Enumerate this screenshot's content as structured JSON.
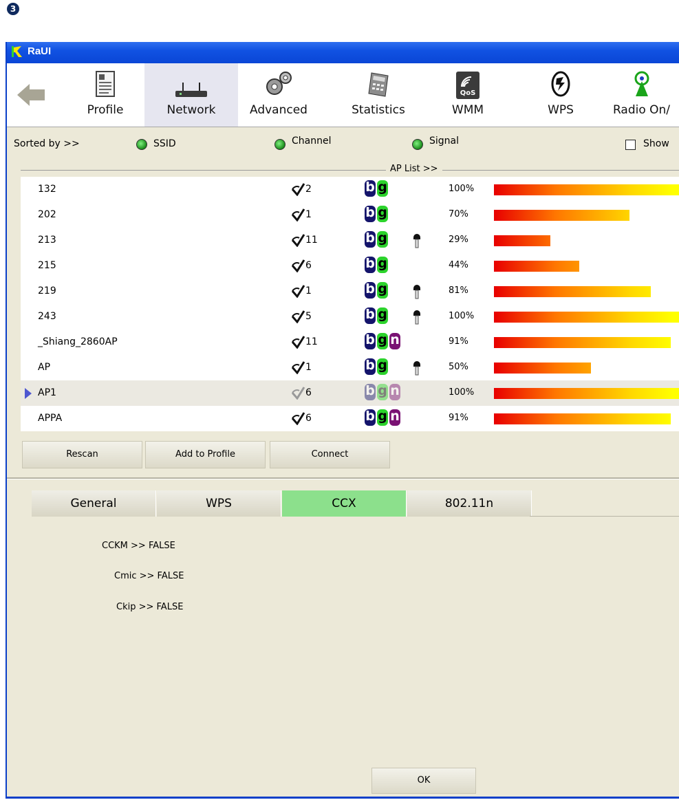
{
  "step_badge": "3",
  "window": {
    "title": "RaUI"
  },
  "toolbar": {
    "items": [
      {
        "label": "Profile"
      },
      {
        "label": "Network"
      },
      {
        "label": "Advanced"
      },
      {
        "label": "Statistics"
      },
      {
        "label": "WMM",
        "icon_text": "QoS"
      },
      {
        "label": "WPS"
      },
      {
        "label": "Radio On/"
      }
    ]
  },
  "sort": {
    "label": "Sorted by >>",
    "options": [
      "SSID",
      "Channel",
      "Signal"
    ],
    "show_checkbox_label": "Show"
  },
  "ap_list": {
    "label": "AP List >>",
    "rows": [
      {
        "ssid": "132",
        "channel": "2",
        "modes": [
          "b",
          "g"
        ],
        "secured": false,
        "signal_text": "100%",
        "signal": 100
      },
      {
        "ssid": "202",
        "channel": "1",
        "modes": [
          "b",
          "g"
        ],
        "secured": false,
        "signal_text": "70%",
        "signal": 70
      },
      {
        "ssid": "213",
        "channel": "11",
        "modes": [
          "b",
          "g"
        ],
        "secured": true,
        "signal_text": "29%",
        "signal": 29
      },
      {
        "ssid": "215",
        "channel": "6",
        "modes": [
          "b",
          "g"
        ],
        "secured": false,
        "signal_text": "44%",
        "signal": 44
      },
      {
        "ssid": "219",
        "channel": "1",
        "modes": [
          "b",
          "g"
        ],
        "secured": true,
        "signal_text": "81%",
        "signal": 81
      },
      {
        "ssid": "243",
        "channel": "5",
        "modes": [
          "b",
          "g"
        ],
        "secured": true,
        "signal_text": "100%",
        "signal": 100
      },
      {
        "ssid": "_Shiang_2860AP",
        "channel": "11",
        "modes": [
          "b",
          "g",
          "n"
        ],
        "secured": false,
        "signal_text": "91%",
        "signal": 91
      },
      {
        "ssid": "AP",
        "channel": "1",
        "modes": [
          "b",
          "g"
        ],
        "secured": true,
        "signal_text": "50%",
        "signal": 50
      },
      {
        "ssid": "AP1",
        "channel": "6",
        "modes": [
          "b",
          "g",
          "n"
        ],
        "secured": false,
        "signal_text": "100%",
        "signal": 100,
        "selected": true
      },
      {
        "ssid": "APPA",
        "channel": "6",
        "modes": [
          "b",
          "g",
          "n"
        ],
        "secured": false,
        "signal_text": "91%",
        "signal": 91
      }
    ]
  },
  "buttons": {
    "rescan": "Rescan",
    "add_to_profile": "Add to Profile",
    "connect": "Connect"
  },
  "tabs": [
    "General",
    "WPS",
    "CCX",
    "802.11n"
  ],
  "active_tab": "CCX",
  "ccx": {
    "cckm": "CCKM >> FALSE",
    "cmic": "Cmic >> FALSE",
    "ckip": "Ckip >> FALSE"
  },
  "ok_button": "OK"
}
